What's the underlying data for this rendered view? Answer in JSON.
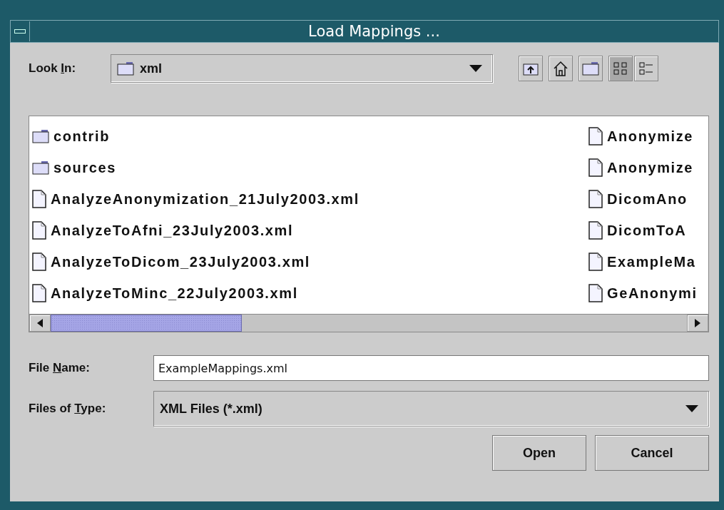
{
  "window": {
    "title": "Load Mappings ..."
  },
  "look_in": {
    "label_parts": [
      "Look ",
      "I",
      "n:"
    ],
    "value": "xml"
  },
  "view_buttons": [
    {
      "selected": true
    },
    {
      "selected": false
    }
  ],
  "files": {
    "columns": [
      [
        {
          "kind": "folder",
          "name": "contrib"
        },
        {
          "kind": "folder",
          "name": "sources"
        },
        {
          "kind": "file",
          "name": "AnalyzeAnonymization_21July2003.xml"
        },
        {
          "kind": "file",
          "name": "AnalyzeToAfni_23July2003.xml"
        },
        {
          "kind": "file",
          "name": "AnalyzeToDicom_23July2003.xml"
        },
        {
          "kind": "file",
          "name": "AnalyzeToMinc_22July2003.xml"
        }
      ],
      [
        {
          "kind": "file",
          "name": "Anonymize"
        },
        {
          "kind": "file",
          "name": "Anonymize"
        },
        {
          "kind": "file",
          "name": "DicomAno"
        },
        {
          "kind": "file",
          "name": "DicomToA"
        },
        {
          "kind": "file",
          "name": "ExampleMa"
        },
        {
          "kind": "file",
          "name": "GeAnonymi"
        }
      ]
    ],
    "scrollbar": {
      "level": 0.3
    }
  },
  "file_name": {
    "label_parts": [
      "File ",
      "N",
      "ame:"
    ],
    "value": "ExampleMappings.xml"
  },
  "file_type": {
    "label_parts": [
      "Files of ",
      "T",
      "ype:"
    ],
    "value": "XML Files (*.xml)"
  },
  "buttons": [
    "Open",
    "Cancel"
  ]
}
